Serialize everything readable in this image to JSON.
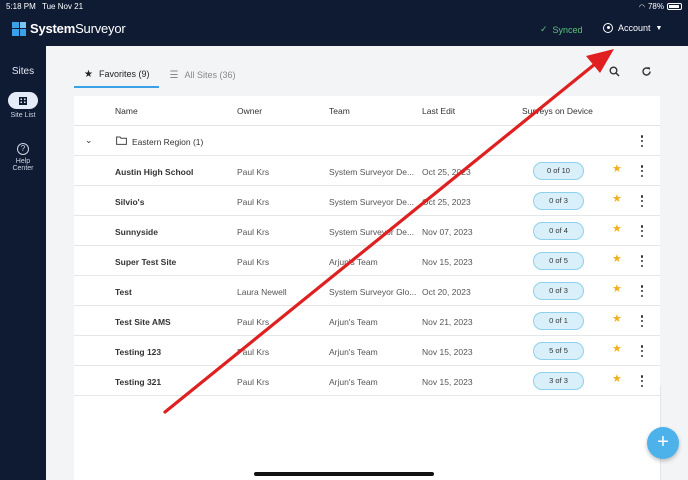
{
  "status": {
    "time": "5:18 PM",
    "date": "Tue Nov 21",
    "battery": "78%"
  },
  "header": {
    "brand_bold": "System",
    "brand_light": "Surveyor",
    "synced_label": "Synced",
    "account_label": "Account"
  },
  "sidebar": {
    "title": "Sites",
    "site_list_label": "Site List",
    "help_label_1": "Help",
    "help_label_2": "Center"
  },
  "tabs": {
    "favorites_label": "Favorites (9)",
    "all_sites_label": "All Sites (36)"
  },
  "table": {
    "headers": [
      "Name",
      "Owner",
      "Team",
      "Last Edit",
      "Surveys on Device"
    ],
    "group_label": "Eastern Region (1)",
    "rows": [
      {
        "name": "Austin High School",
        "owner": "Paul Krs",
        "team": "System Surveyor De...",
        "last_edit": "Oct 25, 2023",
        "surveys": "0 of 10"
      },
      {
        "name": "Silvio's",
        "owner": "Paul Krs",
        "team": "System Surveyor De...",
        "last_edit": "Oct 25, 2023",
        "surveys": "0 of 3"
      },
      {
        "name": "Sunnyside",
        "owner": "Paul Krs",
        "team": "System Surveyor De...",
        "last_edit": "Nov 07, 2023",
        "surveys": "0 of 4"
      },
      {
        "name": "Super Test Site",
        "owner": "Paul Krs",
        "team": "Arjun's Team",
        "last_edit": "Nov 15, 2023",
        "surveys": "0 of 5"
      },
      {
        "name": "Test",
        "owner": "Laura Newell",
        "team": "System Surveyor Glo...",
        "last_edit": "Oct 20, 2023",
        "surveys": "0 of 3"
      },
      {
        "name": "Test Site AMS",
        "owner": "Paul Krs",
        "team": "Arjun's Team",
        "last_edit": "Nov 21, 2023",
        "surveys": "0 of 1"
      },
      {
        "name": "Testing 123",
        "owner": "Paul Krs",
        "team": "Arjun's Team",
        "last_edit": "Nov 15, 2023",
        "surveys": "5 of 5"
      },
      {
        "name": "Testing 321",
        "owner": "Paul Krs",
        "team": "Arjun's Team",
        "last_edit": "Nov 15, 2023",
        "surveys": "3 of 3"
      }
    ]
  },
  "fab_label": "+",
  "colors": {
    "nav_bg": "#0f1b33",
    "accent": "#3aa0e8",
    "synced": "#5cc27a",
    "star": "#f2b01e",
    "annotation_arrow": "#e02020"
  }
}
